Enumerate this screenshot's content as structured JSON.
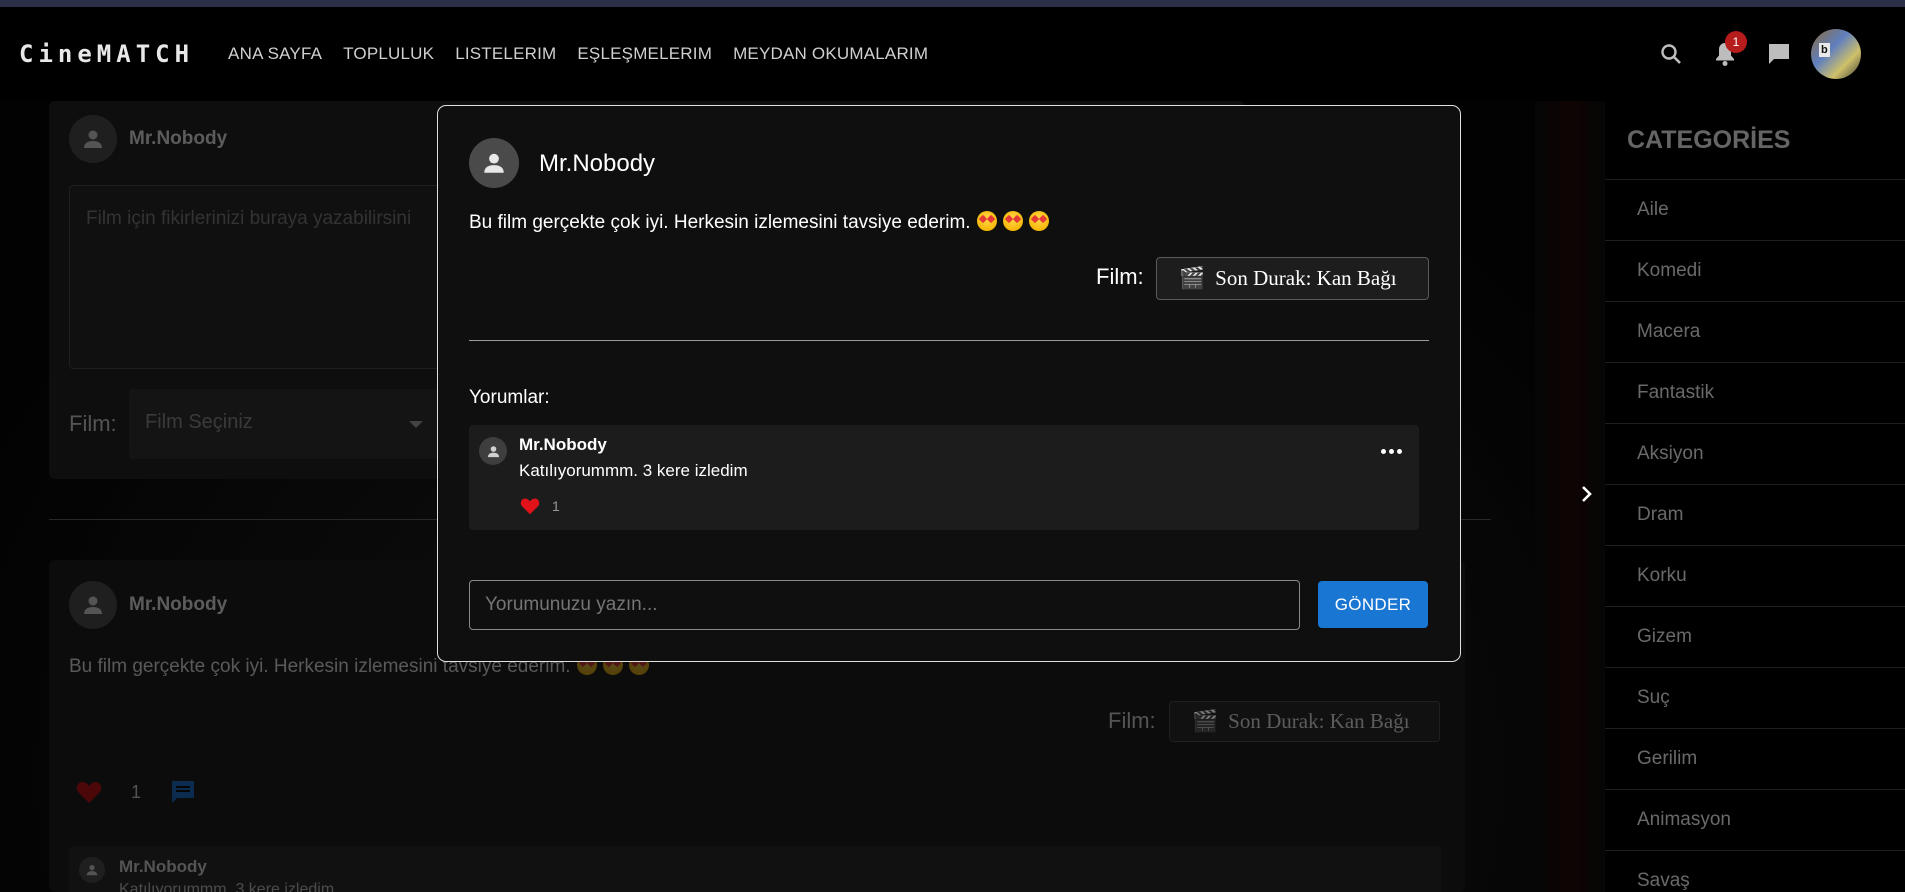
{
  "navbar": {
    "logo": "CineMATCH",
    "links": [
      "ANA SAYFA",
      "TOPLULUK",
      "LISTELERIM",
      "EŞLEŞMELERIM",
      "MEYDAN OKUMALARIM"
    ],
    "notification_count": "1",
    "avatar_text": "b"
  },
  "background": {
    "composer": {
      "username": "Mr.Nobody",
      "textarea_placeholder": "Film için fikirlerinizi buraya yazabilirsini",
      "film_label": "Film:",
      "select_placeholder": "Film Seçiniz"
    },
    "post": {
      "username": "Mr.Nobody",
      "body": "Bu film gerçekte çok iyi. Herkesin izlemesini tavsiye ederim.",
      "film_label": "Film:",
      "film_name": "Son Durak: Kan Bağı",
      "like_count": "1",
      "comment_username": "Mr.Nobody",
      "comment_text": "Katılıyorummm. 3 kere izledim"
    }
  },
  "sidebar": {
    "title": "CATEGORİES",
    "categories": [
      "Aile",
      "Komedi",
      "Macera",
      "Fantastik",
      "Aksiyon",
      "Dram",
      "Korku",
      "Gizem",
      "Suç",
      "Gerilim",
      "Animasyon",
      "Savaş"
    ]
  },
  "modal": {
    "username": "Mr.Nobody",
    "body": "Bu film gerçekte çok iyi. Herkesin izlemesini tavsiye ederim.",
    "film_label": "Film:",
    "film_name": "Son Durak: Kan Bağı",
    "comments_title": "Yorumlar:",
    "comments": [
      {
        "username": "Mr.Nobody",
        "text": "Katılıyorummm. 3 kere izledim",
        "likes": "1"
      }
    ],
    "input_placeholder": "Yorumunuzu yazın...",
    "send_label": "GÖNDER"
  },
  "colors": {
    "accent": "#1976d2",
    "heart": "#e0131b",
    "badge": "#b71c1c"
  }
}
